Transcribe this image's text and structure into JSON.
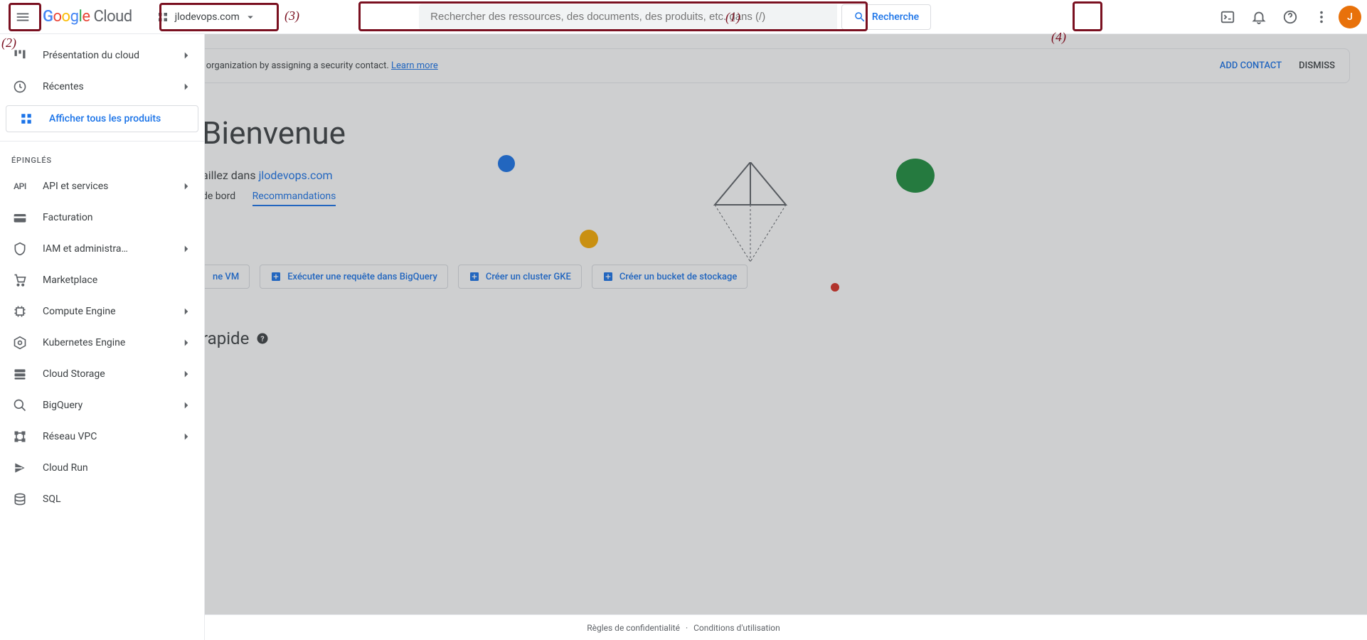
{
  "header": {
    "logo": "Google Cloud",
    "project": "jlodevops.com",
    "search_placeholder": "Rechercher des ressources, des documents, des produits, etc. dans (/)",
    "search_button": "Recherche",
    "avatar_initial": "J"
  },
  "annotations": {
    "a1": "(1)",
    "a2": "(2)",
    "a3": "(3)",
    "a4": "(4)"
  },
  "drawer": {
    "top": [
      {
        "label": "Présentation du cloud",
        "icon": "dashboard",
        "chevron": true
      },
      {
        "label": "Récentes",
        "icon": "clock",
        "chevron": true
      }
    ],
    "show_all": "Afficher tous les produits",
    "pinned_header": "ÉPINGLÉS",
    "pinned": [
      {
        "label": "API et services",
        "icon": "api",
        "chevron": true
      },
      {
        "label": "Facturation",
        "icon": "billing",
        "chevron": false
      },
      {
        "label": "IAM et administra…",
        "icon": "iam",
        "chevron": true
      },
      {
        "label": "Marketplace",
        "icon": "marketplace",
        "chevron": false
      },
      {
        "label": "Compute Engine",
        "icon": "compute",
        "chevron": true
      },
      {
        "label": "Kubernetes Engine",
        "icon": "k8s",
        "chevron": true
      },
      {
        "label": "Cloud Storage",
        "icon": "storage",
        "chevron": true
      },
      {
        "label": "BigQuery",
        "icon": "bq",
        "chevron": true
      },
      {
        "label": "Réseau VPC",
        "icon": "vpc",
        "chevron": true
      },
      {
        "label": "Cloud Run",
        "icon": "run",
        "chevron": false
      },
      {
        "label": "SQL",
        "icon": "sql",
        "chevron": false
      }
    ]
  },
  "banner": {
    "text": "nerabilities, and data incidents within your organization by assigning a security contact.",
    "learn_more": "Learn more",
    "add_contact": "ADD CONTACT",
    "dismiss": "DISMISS"
  },
  "welcome": {
    "title": "Bienvenue",
    "subtitle_prefix": "aillez dans  ",
    "subtitle_link": "jlodevops.com",
    "tab1": "de bord",
    "tab2": "Recommandations"
  },
  "pills": {
    "vm": "ne VM",
    "bigquery": "Exécuter une requête dans BigQuery",
    "gke": "Créer un cluster GKE",
    "bucket": "Créer un bucket de stockage"
  },
  "access": {
    "title": "rapide"
  },
  "footer": {
    "privacy": "Règles de confidentialité",
    "sep": "·",
    "terms": "Conditions d'utilisation"
  }
}
